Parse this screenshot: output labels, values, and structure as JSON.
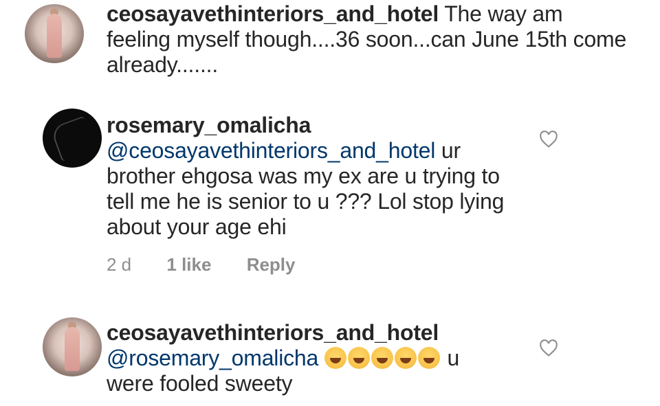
{
  "comments": [
    {
      "username": "ceosayavethinteriors_and_hotel",
      "text": " The way am feeling myself though....36 soon...can June 15th come already......."
    },
    {
      "username": "rosemary_omalicha",
      "mention": "@ceosayavethinteriors_and_hotel",
      "text": " ur brother ehgosa was my ex are u trying to tell me he is senior to u ??? Lol stop lying about your age ehi",
      "time": "2 d",
      "likes": "1 like",
      "reply": "Reply"
    },
    {
      "username": "ceosayavethinteriors_and_hotel",
      "mention": "@rosemary_omalicha",
      "emoji": "face-with-tears-of-joy-icon",
      "emoji_count": 5,
      "text": " u were fooled sweety"
    }
  ]
}
